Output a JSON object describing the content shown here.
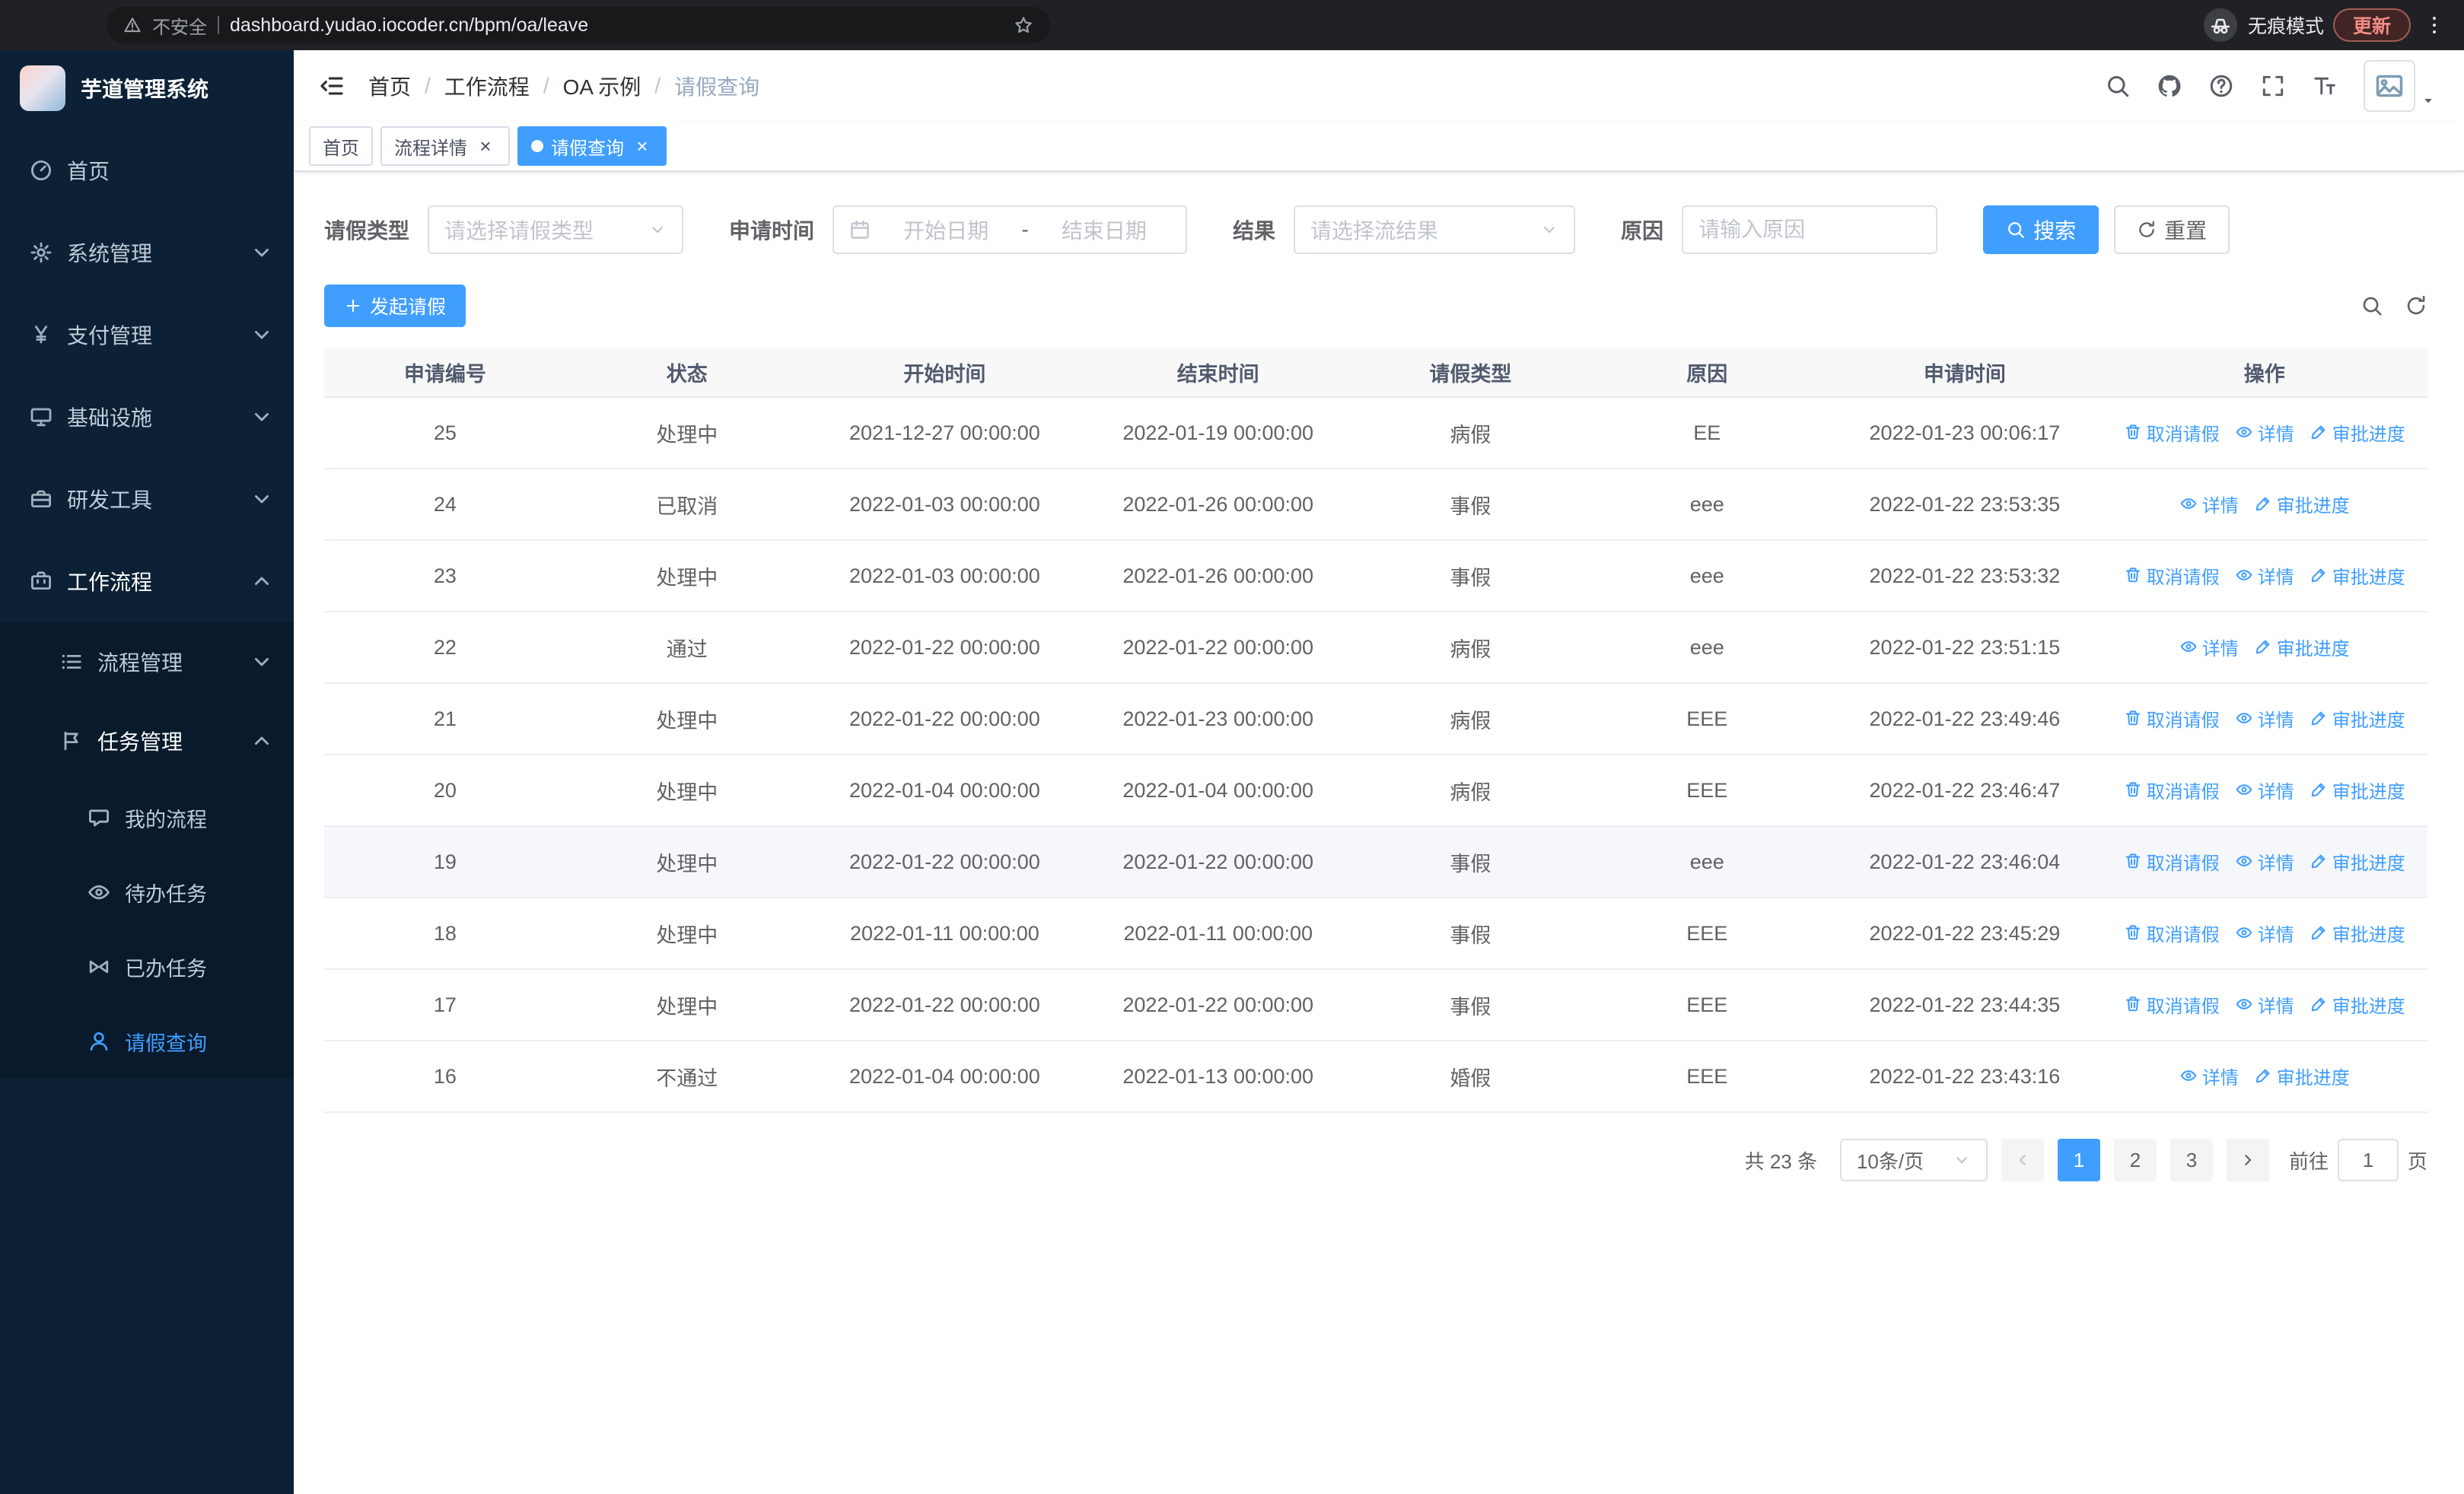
{
  "colors": {
    "accent": "#409eff",
    "sidebar_bg": "#0c2135",
    "submenu_bg": "#081a2b",
    "chrome_bg": "#202124"
  },
  "browser": {
    "security_warning": "不安全",
    "url": "dashboard.yudao.iocoder.cn/bpm/oa/leave",
    "incognito_label": "无痕模式",
    "update_label": "更新"
  },
  "sidebar": {
    "app_title": "芋道管理系统",
    "menu": [
      {
        "name": "home",
        "label": "首页",
        "icon": "dashboard-icon",
        "level": 1
      },
      {
        "name": "system",
        "label": "系统管理",
        "icon": "gear-icon",
        "level": 1,
        "chevron": "down"
      },
      {
        "name": "payment",
        "label": "支付管理",
        "icon": "yen-icon",
        "level": 1,
        "chevron": "down"
      },
      {
        "name": "infrastructure",
        "label": "基础设施",
        "icon": "monitor-icon",
        "level": 1,
        "chevron": "down"
      },
      {
        "name": "devtools",
        "label": "研发工具",
        "icon": "toolbox-icon",
        "level": 1,
        "chevron": "down"
      },
      {
        "name": "workflow",
        "label": "工作流程",
        "icon": "briefcase-icon",
        "level": 1,
        "chevron": "up",
        "open": true
      },
      {
        "name": "process-management",
        "label": "流程管理",
        "icon": "list-icon",
        "level": 2,
        "chevron": "down",
        "sub": true
      },
      {
        "name": "task-management",
        "label": "任务管理",
        "icon": "flag-icon",
        "level": 2,
        "chevron": "up",
        "sub": true,
        "open": true
      },
      {
        "name": "my-process",
        "label": "我的流程",
        "icon": "chat-icon",
        "level": 3,
        "sub": true
      },
      {
        "name": "todo-tasks",
        "label": "待办任务",
        "icon": "eye-icon",
        "level": 3,
        "sub": true
      },
      {
        "name": "done-tasks",
        "label": "已办任务",
        "icon": "bowtie-icon",
        "level": 3,
        "sub": true
      },
      {
        "name": "leave-query",
        "label": "请假查询",
        "icon": "user-icon",
        "level": 3,
        "sub": true,
        "active": true
      }
    ]
  },
  "breadcrumb": {
    "items": [
      "首页",
      "工作流程",
      "OA 示例",
      "请假查询"
    ]
  },
  "tabs": [
    {
      "name": "home",
      "label": "首页",
      "closable": false,
      "active": false
    },
    {
      "name": "process-detail",
      "label": "流程详情",
      "closable": true,
      "active": false
    },
    {
      "name": "leave-query",
      "label": "请假查询",
      "closable": true,
      "active": true
    }
  ],
  "filters": {
    "leave_type_label": "请假类型",
    "leave_type_placeholder": "请选择请假类型",
    "apply_time_label": "申请时间",
    "start_date_placeholder": "开始日期",
    "date_separator": "-",
    "end_date_placeholder": "结束日期",
    "result_label": "结果",
    "result_placeholder": "请选择流结果",
    "reason_label": "原因",
    "reason_placeholder": "请输入原因",
    "search_button": "搜索",
    "reset_button": "重置"
  },
  "toolbar": {
    "create_button": "发起请假"
  },
  "table": {
    "columns": [
      "申请编号",
      "状态",
      "开始时间",
      "结束时间",
      "请假类型",
      "原因",
      "申请时间",
      "操作"
    ],
    "actions": {
      "cancel": "取消请假",
      "detail": "详情",
      "progress": "审批进度"
    },
    "rows": [
      {
        "id": "25",
        "status": "处理中",
        "start": "2021-12-27 00:00:00",
        "end": "2022-01-19 00:00:00",
        "type": "病假",
        "reason": "EE",
        "applied": "2022-01-23 00:06:17",
        "cancellable": true,
        "hover": false
      },
      {
        "id": "24",
        "status": "已取消",
        "start": "2022-01-03 00:00:00",
        "end": "2022-01-26 00:00:00",
        "type": "事假",
        "reason": "eee",
        "applied": "2022-01-22 23:53:35",
        "cancellable": false,
        "hover": false
      },
      {
        "id": "23",
        "status": "处理中",
        "start": "2022-01-03 00:00:00",
        "end": "2022-01-26 00:00:00",
        "type": "事假",
        "reason": "eee",
        "applied": "2022-01-22 23:53:32",
        "cancellable": true,
        "hover": false
      },
      {
        "id": "22",
        "status": "通过",
        "start": "2022-01-22 00:00:00",
        "end": "2022-01-22 00:00:00",
        "type": "病假",
        "reason": "eee",
        "applied": "2022-01-22 23:51:15",
        "cancellable": false,
        "hover": false
      },
      {
        "id": "21",
        "status": "处理中",
        "start": "2022-01-22 00:00:00",
        "end": "2022-01-23 00:00:00",
        "type": "病假",
        "reason": "EEE",
        "applied": "2022-01-22 23:49:46",
        "cancellable": true,
        "hover": false
      },
      {
        "id": "20",
        "status": "处理中",
        "start": "2022-01-04 00:00:00",
        "end": "2022-01-04 00:00:00",
        "type": "病假",
        "reason": "EEE",
        "applied": "2022-01-22 23:46:47",
        "cancellable": true,
        "hover": false
      },
      {
        "id": "19",
        "status": "处理中",
        "start": "2022-01-22 00:00:00",
        "end": "2022-01-22 00:00:00",
        "type": "事假",
        "reason": "eee",
        "applied": "2022-01-22 23:46:04",
        "cancellable": true,
        "hover": true
      },
      {
        "id": "18",
        "status": "处理中",
        "start": "2022-01-11 00:00:00",
        "end": "2022-01-11 00:00:00",
        "type": "事假",
        "reason": "EEE",
        "applied": "2022-01-22 23:45:29",
        "cancellable": true,
        "hover": false
      },
      {
        "id": "17",
        "status": "处理中",
        "start": "2022-01-22 00:00:00",
        "end": "2022-01-22 00:00:00",
        "type": "事假",
        "reason": "EEE",
        "applied": "2022-01-22 23:44:35",
        "cancellable": true,
        "hover": false
      },
      {
        "id": "16",
        "status": "不通过",
        "start": "2022-01-04 00:00:00",
        "end": "2022-01-13 00:00:00",
        "type": "婚假",
        "reason": "EEE",
        "applied": "2022-01-22 23:43:16",
        "cancellable": false,
        "hover": false
      }
    ]
  },
  "pagination": {
    "total": "共 23 条",
    "page_size": "10条/页",
    "pages": [
      "1",
      "2",
      "3"
    ],
    "active_page": "1",
    "goto_label": "前往",
    "goto_value": "1",
    "goto_suffix": "页"
  }
}
